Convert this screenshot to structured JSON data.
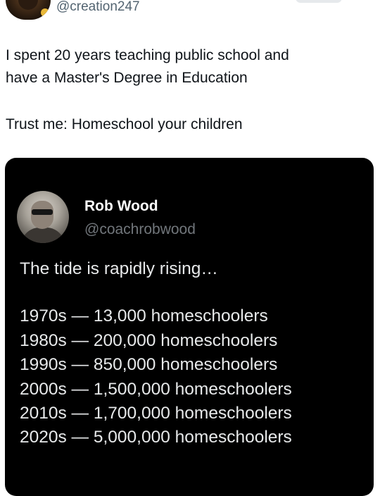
{
  "post": {
    "handle": "@creation247",
    "text_line1": "I spent 20 years teaching public school and",
    "text_line2": "have a Master's Degree in Education",
    "text_line3": "Trust me: Homeschool your children"
  },
  "quoted_post": {
    "author_name": "Rob Wood",
    "author_handle": "@coachrobwood",
    "lead": "The tide is rapidly rising…",
    "lines": [
      "1970s — 13,000 homeschoolers",
      "1980s — 200,000 homeschoolers",
      "1990s — 850,000 homeschoolers",
      "2000s — 1,500,000 homeschoolers",
      "2010s — 1,700,000 homeschoolers",
      "2020s — 5,000,000 homeschoolers"
    ]
  }
}
